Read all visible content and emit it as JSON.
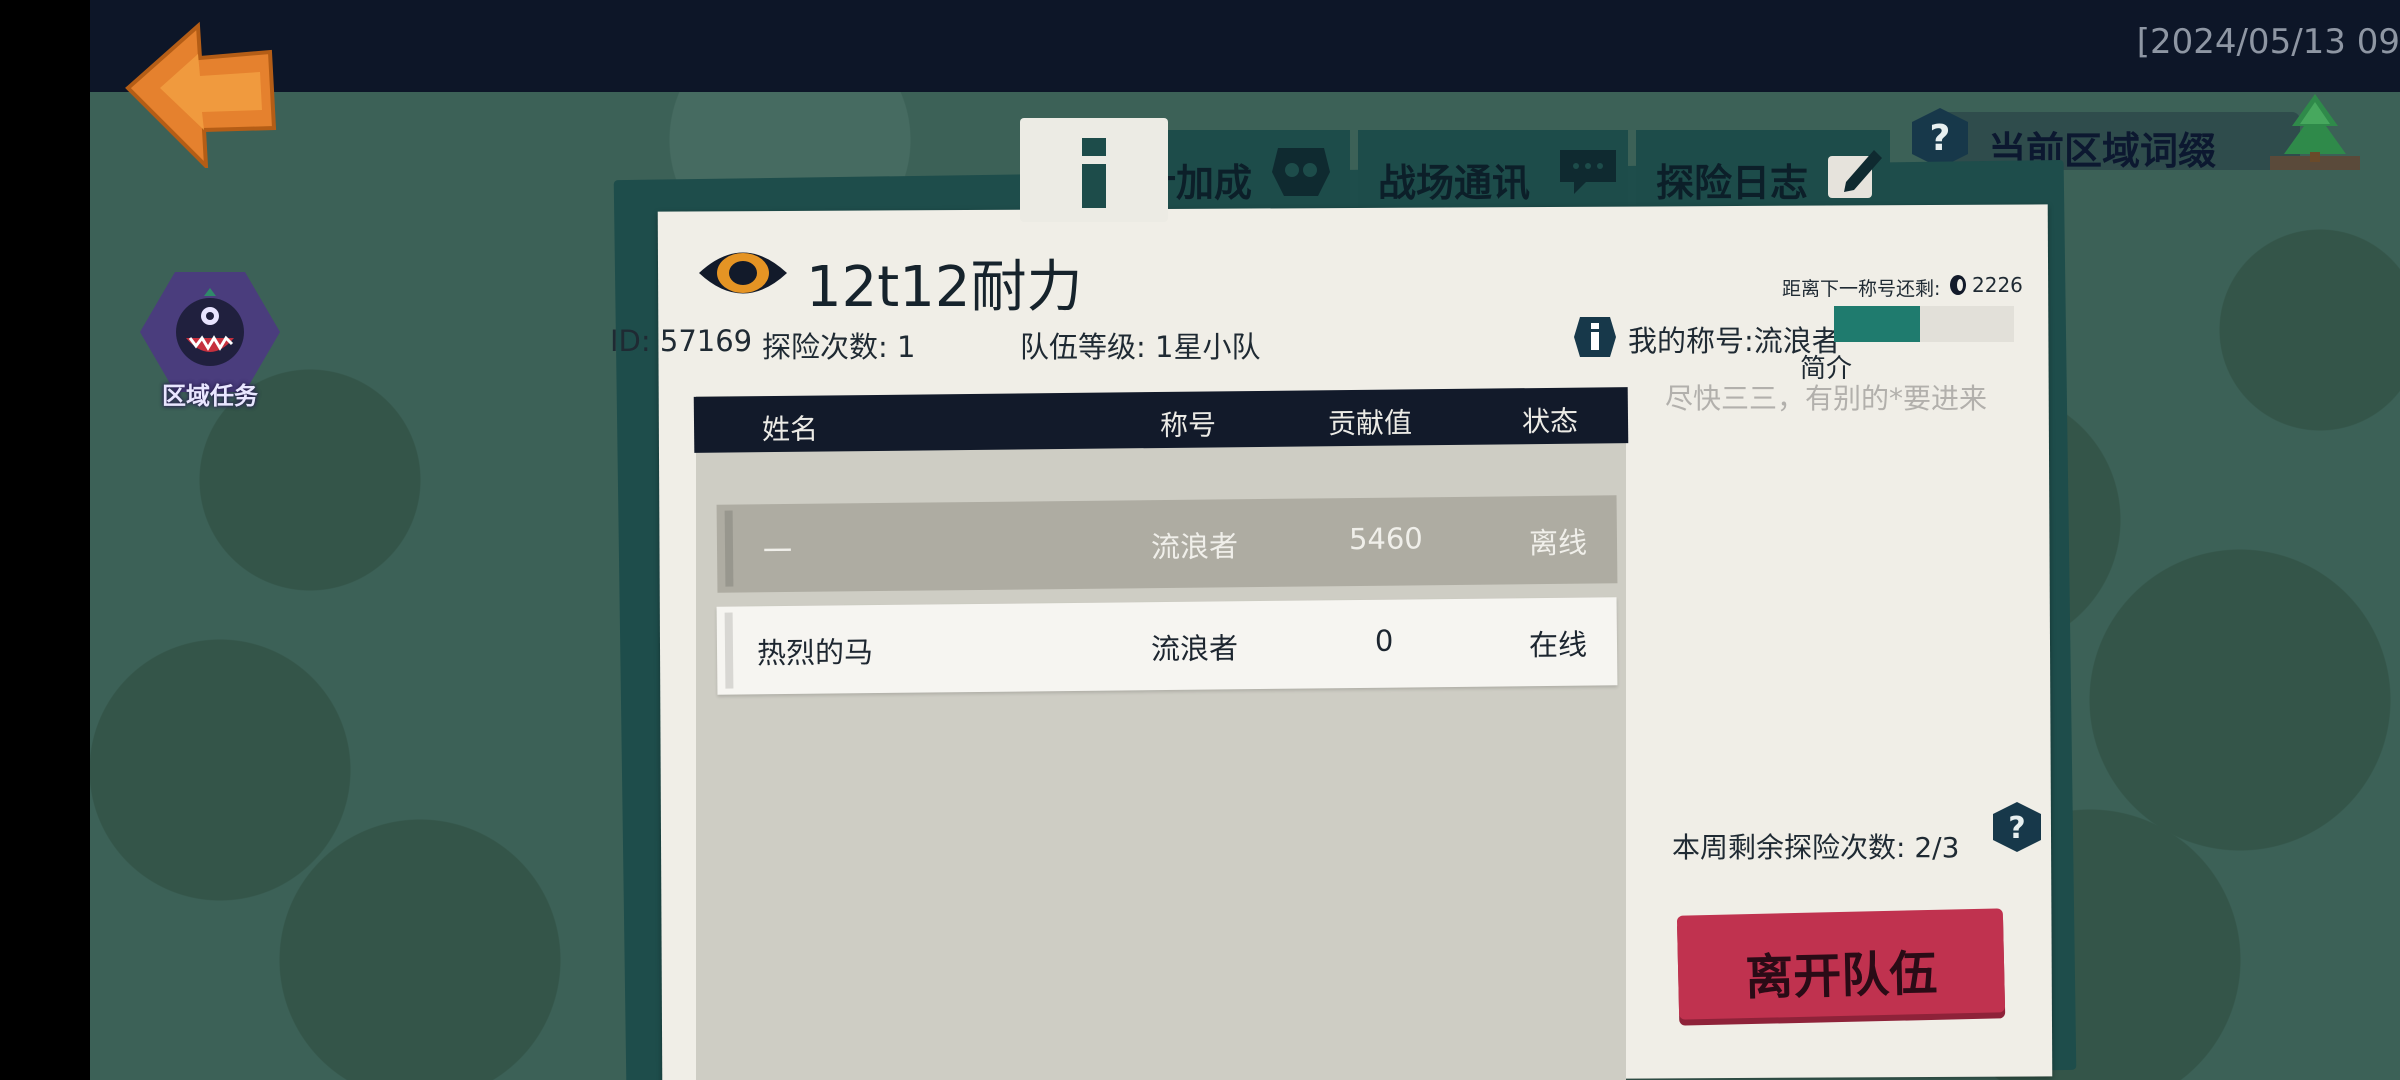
{
  "status_bar": {
    "datetime": "[2024/05/13 09"
  },
  "nav": {
    "region_task_label": "区域任务",
    "region_affix_label": "当前区域词缀"
  },
  "tabs": [
    {
      "label": "累计加成"
    },
    {
      "label": "战场通讯"
    },
    {
      "label": "探险日志"
    }
  ],
  "team": {
    "name": "12t12耐力",
    "id": "ID: 57169",
    "expeditions": "探险次数: 1",
    "level": "队伍等级: 1星小队",
    "next_title_label": "距离下一称号还剩:",
    "next_title_value": "2226",
    "my_title": "我的称号:流浪者",
    "title_progress": 0.48,
    "intro_label": "简介",
    "intro_text": "尽快三三，有别的*要进来"
  },
  "table": {
    "headers": [
      "姓名",
      "称号",
      "贡献值",
      "状态"
    ],
    "rows": [
      {
        "name": "一",
        "title": "流浪者",
        "contribution": "5460",
        "status": "离线"
      },
      {
        "name": "热烈的马",
        "title": "流浪者",
        "contribution": "0",
        "status": "在线"
      }
    ]
  },
  "weekly": {
    "remaining": "本周剩余探险次数:  2/3"
  },
  "actions": {
    "leave_label": "离开队伍"
  },
  "colors": {
    "accent": "#1f7b6e",
    "leave": "#c0324f",
    "header": "#121a2a"
  }
}
